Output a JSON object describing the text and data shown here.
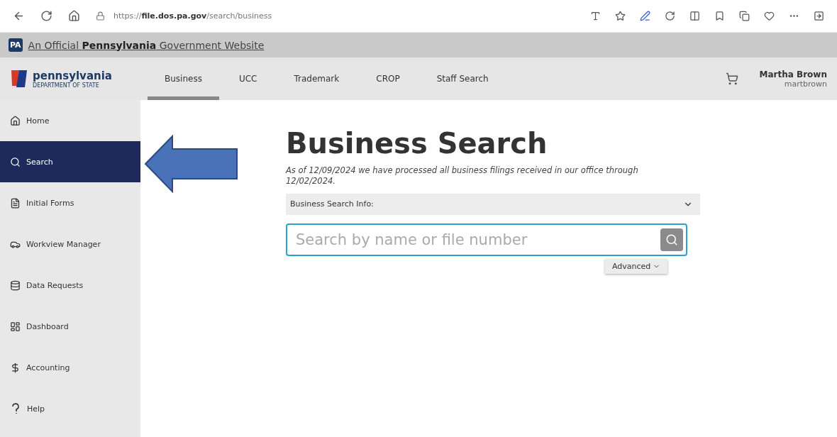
{
  "browser": {
    "url": "https://**file.dos.pa.gov**/search/business"
  },
  "gov_banner": {
    "badge": "PA",
    "text": "An Official **Pennsylvania** Government Website"
  },
  "header": {
    "logo": {
      "name": "pennsylvania",
      "subtitle": "DEPARTMENT OF STATE"
    },
    "tabs": [
      {
        "label": "Business",
        "selected": true
      },
      {
        "label": "UCC",
        "selected": false
      },
      {
        "label": "Trademark",
        "selected": false
      },
      {
        "label": "CROP",
        "selected": false
      },
      {
        "label": "Staff Search",
        "selected": false
      }
    ],
    "user": {
      "name": "Martha Brown",
      "username": "martbrown"
    }
  },
  "sidebar": {
    "items": [
      {
        "label": "Home",
        "selected": false
      },
      {
        "label": "Search",
        "selected": true
      },
      {
        "label": "Initial Forms",
        "selected": false
      },
      {
        "label": "Workview Manager",
        "selected": false
      },
      {
        "label": "Data Requests",
        "selected": false
      },
      {
        "label": "Dashboard",
        "selected": false
      },
      {
        "label": "Accounting",
        "selected": false
      },
      {
        "label": "Help",
        "selected": false
      }
    ]
  },
  "main": {
    "title": "Business Search",
    "notice": "As of 12/09/2024 we have processed all business filings received in our office through 12/02/2024.",
    "info_dropdown": {
      "label": "Business Search Info:",
      "expanded": false
    },
    "search": {
      "placeholder": "Search by name or file number"
    },
    "advanced_button": "Advanced"
  }
}
